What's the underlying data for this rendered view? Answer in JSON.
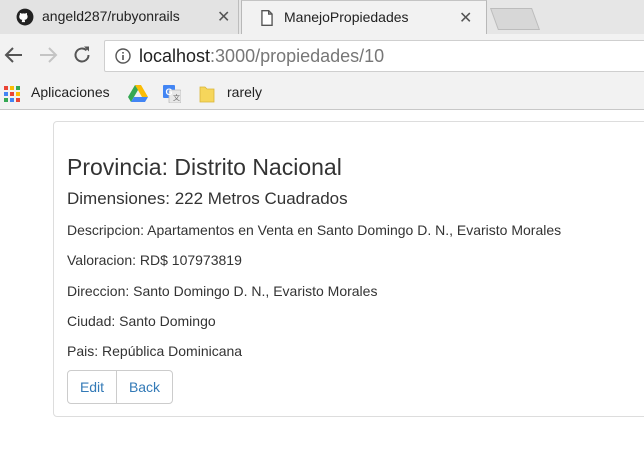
{
  "browser": {
    "tabs": [
      {
        "title": "angeld287/rubyonrails",
        "icon": "github-icon",
        "active": false
      },
      {
        "title": "ManejoPropiedades",
        "icon": "document-icon",
        "active": true
      }
    ],
    "close_glyph": "✕",
    "url_host": "localhost",
    "url_rest": ":3000/propiedades/10",
    "bookmarks": [
      {
        "label": "Aplicaciones",
        "icon": "apps-grid-icon"
      },
      {
        "label": "",
        "icon": "google-drive-icon"
      },
      {
        "label": "",
        "icon": "google-translate-icon"
      },
      {
        "label": "rarely",
        "icon": "folder-icon"
      }
    ]
  },
  "page": {
    "provincia": "Provincia: Distrito Nacional",
    "dimensiones": "Dimensiones: 222 Metros Cuadrados",
    "descripcion": "Descripcion: Apartamentos en Venta en Santo Domingo D. N., Evaristo Morales",
    "valoracion": "Valoracion: RD$ 107973819",
    "direccion": "Direccion: Santo Domingo D. N., Evaristo Morales",
    "ciudad": "Ciudad: Santo Domingo",
    "pais": "Pais: República Dominicana",
    "edit_label": "Edit",
    "back_label": "Back"
  },
  "colors": {
    "link": "#337ab7",
    "text": "#333333",
    "chrome_bg": "#f2f2f2"
  }
}
